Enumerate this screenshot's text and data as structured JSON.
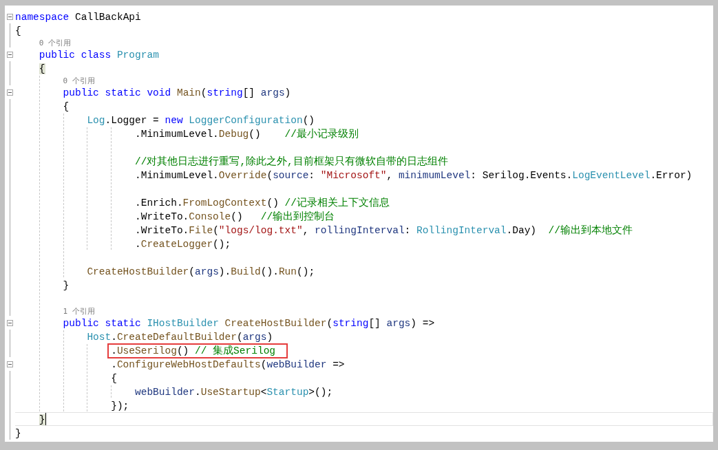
{
  "lines": [
    {
      "kind": "code",
      "expanded": true,
      "tokens": [
        {
          "kind": "kw",
          "text": "namespace"
        },
        {
          "kind": "plain",
          "text": " CallBackApi"
        }
      ]
    },
    {
      "kind": "code",
      "tokens": [
        {
          "kind": "plain",
          "text": "{"
        }
      ],
      "children": [
        {
          "kind": "lens",
          "text": "0 个引用"
        },
        {
          "kind": "code",
          "expanded": true,
          "tokens": [
            {
              "kind": "kw",
              "text": "public class"
            },
            {
              "kind": "type",
              "text": " Program"
            }
          ]
        },
        {
          "kind": "code",
          "tokens": [
            {
              "kind": "brace",
              "text": "{"
            }
          ],
          "children": [
            {
              "kind": "lens",
              "text": "0 个引用"
            },
            {
              "kind": "code",
              "expanded": true,
              "tokens": [
                {
                  "kind": "kw",
                  "text": "public static void"
                },
                {
                  "kind": "method",
                  "text": " Main"
                },
                {
                  "kind": "plain",
                  "text": "("
                },
                {
                  "kind": "kw",
                  "text": "string"
                },
                {
                  "kind": "plain",
                  "text": "[] "
                },
                {
                  "kind": "param",
                  "text": "args"
                },
                {
                  "kind": "plain",
                  "text": ")"
                }
              ]
            },
            {
              "kind": "code",
              "tokens": [
                {
                  "kind": "plain",
                  "text": "{"
                }
              ],
              "children": [
                {
                  "kind": "code",
                  "tokens": [
                    {
                      "kind": "type",
                      "text": "Log"
                    },
                    {
                      "kind": "plain",
                      "text": ".Logger = "
                    },
                    {
                      "kind": "kw",
                      "text": "new"
                    },
                    {
                      "kind": "type",
                      "text": " LoggerConfiguration"
                    },
                    {
                      "kind": "plain",
                      "text": "()"
                    }
                  ],
                  "children": [
                    {
                      "kind": "group",
                      "children": [
                        {
                          "kind": "code",
                          "tokens": [
                            {
                              "kind": "plain",
                              "text": ".MinimumLevel."
                            },
                            {
                              "kind": "method",
                              "text": "Debug"
                            },
                            {
                              "kind": "plain",
                              "text": "()    "
                            },
                            {
                              "kind": "cmt",
                              "text": "//最小记录级别"
                            }
                          ]
                        },
                        {
                          "kind": "blank"
                        },
                        {
                          "kind": "code",
                          "tokens": [
                            {
                              "kind": "cmt",
                              "text": "//对其他日志进行重写,除此之外,目前框架只有微软自带的日志组件"
                            }
                          ]
                        },
                        {
                          "kind": "code",
                          "tokens": [
                            {
                              "kind": "plain",
                              "text": ".MinimumLevel."
                            },
                            {
                              "kind": "method",
                              "text": "Override"
                            },
                            {
                              "kind": "plain",
                              "text": "("
                            },
                            {
                              "kind": "param",
                              "text": "source"
                            },
                            {
                              "kind": "plain",
                              "text": ": "
                            },
                            {
                              "kind": "str",
                              "text": "\"Microsoft\""
                            },
                            {
                              "kind": "plain",
                              "text": ", "
                            },
                            {
                              "kind": "param",
                              "text": "minimumLevel"
                            },
                            {
                              "kind": "plain",
                              "text": ": Serilog.Events."
                            },
                            {
                              "kind": "type",
                              "text": "LogEventLevel"
                            },
                            {
                              "kind": "plain",
                              "text": ".Error)"
                            }
                          ]
                        },
                        {
                          "kind": "blank"
                        },
                        {
                          "kind": "code",
                          "tokens": [
                            {
                              "kind": "plain",
                              "text": ".Enrich."
                            },
                            {
                              "kind": "method",
                              "text": "FromLogContext"
                            },
                            {
                              "kind": "plain",
                              "text": "() "
                            },
                            {
                              "kind": "cmt",
                              "text": "//记录相关上下文信息"
                            }
                          ]
                        },
                        {
                          "kind": "code",
                          "tokens": [
                            {
                              "kind": "plain",
                              "text": ".WriteTo."
                            },
                            {
                              "kind": "method",
                              "text": "Console"
                            },
                            {
                              "kind": "plain",
                              "text": "()   "
                            },
                            {
                              "kind": "cmt",
                              "text": "//输出到控制台"
                            }
                          ]
                        },
                        {
                          "kind": "code",
                          "tokens": [
                            {
                              "kind": "plain",
                              "text": ".WriteTo."
                            },
                            {
                              "kind": "method",
                              "text": "File"
                            },
                            {
                              "kind": "plain",
                              "text": "("
                            },
                            {
                              "kind": "str",
                              "text": "\"logs/log.txt\""
                            },
                            {
                              "kind": "plain",
                              "text": ", "
                            },
                            {
                              "kind": "param",
                              "text": "rollingInterval"
                            },
                            {
                              "kind": "plain",
                              "text": ": "
                            },
                            {
                              "kind": "type",
                              "text": "RollingInterval"
                            },
                            {
                              "kind": "plain",
                              "text": ".Day)  "
                            },
                            {
                              "kind": "cmt",
                              "text": "//输出到本地文件"
                            }
                          ]
                        },
                        {
                          "kind": "code",
                          "tokens": [
                            {
                              "kind": "plain",
                              "text": "."
                            },
                            {
                              "kind": "method",
                              "text": "CreateLogger"
                            },
                            {
                              "kind": "plain",
                              "text": "();"
                            }
                          ]
                        }
                      ]
                    }
                  ]
                },
                {
                  "kind": "blank"
                },
                {
                  "kind": "code",
                  "tokens": [
                    {
                      "kind": "method",
                      "text": "CreateHostBuilder"
                    },
                    {
                      "kind": "plain",
                      "text": "("
                    },
                    {
                      "kind": "param",
                      "text": "args"
                    },
                    {
                      "kind": "plain",
                      "text": ")."
                    },
                    {
                      "kind": "method",
                      "text": "Build"
                    },
                    {
                      "kind": "plain",
                      "text": "()."
                    },
                    {
                      "kind": "method",
                      "text": "Run"
                    },
                    {
                      "kind": "plain",
                      "text": "();"
                    }
                  ]
                }
              ]
            },
            {
              "kind": "code",
              "tokens": [
                {
                  "kind": "plain",
                  "text": "}"
                }
              ]
            },
            {
              "kind": "blank"
            },
            {
              "kind": "lens",
              "text": "1 个引用"
            },
            {
              "kind": "code",
              "expanded": true,
              "tokens": [
                {
                  "kind": "kw",
                  "text": "public static"
                },
                {
                  "kind": "type",
                  "text": " IHostBuilder"
                },
                {
                  "kind": "method",
                  "text": " CreateHostBuilder"
                },
                {
                  "kind": "plain",
                  "text": "("
                },
                {
                  "kind": "kw",
                  "text": "string"
                },
                {
                  "kind": "plain",
                  "text": "[] "
                },
                {
                  "kind": "param",
                  "text": "args"
                },
                {
                  "kind": "plain",
                  "text": ") =>"
                }
              ],
              "children": [
                {
                  "kind": "code",
                  "tokens": [
                    {
                      "kind": "type",
                      "text": "Host"
                    },
                    {
                      "kind": "plain",
                      "text": "."
                    },
                    {
                      "kind": "method",
                      "text": "CreateDefaultBuilder"
                    },
                    {
                      "kind": "plain",
                      "text": "("
                    },
                    {
                      "kind": "param",
                      "text": "args"
                    },
                    {
                      "kind": "plain",
                      "text": ")"
                    }
                  ],
                  "children": [
                    {
                      "kind": "code",
                      "highlighted": true,
                      "tokens": [
                        {
                          "kind": "plain",
                          "text": "."
                        },
                        {
                          "kind": "method",
                          "text": "UseSerilog"
                        },
                        {
                          "kind": "plain",
                          "text": "() "
                        },
                        {
                          "kind": "cmt",
                          "text": "// 集成Serilog"
                        }
                      ]
                    },
                    {
                      "kind": "code",
                      "expanded": true,
                      "tokens": [
                        {
                          "kind": "plain",
                          "text": "."
                        },
                        {
                          "kind": "method",
                          "text": "ConfigureWebHostDefaults"
                        },
                        {
                          "kind": "plain",
                          "text": "("
                        },
                        {
                          "kind": "param",
                          "text": "webBuilder"
                        },
                        {
                          "kind": "plain",
                          "text": " =>"
                        }
                      ]
                    },
                    {
                      "kind": "code",
                      "tokens": [
                        {
                          "kind": "plain",
                          "text": "{"
                        }
                      ],
                      "children": [
                        {
                          "kind": "code",
                          "tokens": [
                            {
                              "kind": "param",
                              "text": "webBuilder"
                            },
                            {
                              "kind": "plain",
                              "text": "."
                            },
                            {
                              "kind": "method",
                              "text": "UseStartup"
                            },
                            {
                              "kind": "plain",
                              "text": "<"
                            },
                            {
                              "kind": "type",
                              "text": "Startup"
                            },
                            {
                              "kind": "plain",
                              "text": ">();"
                            }
                          ]
                        }
                      ]
                    },
                    {
                      "kind": "code",
                      "tokens": [
                        {
                          "kind": "plain",
                          "text": "});"
                        }
                      ]
                    }
                  ]
                }
              ]
            }
          ]
        },
        {
          "kind": "code",
          "current": true,
          "tokens": [
            {
              "kind": "brace",
              "text": "}"
            }
          ]
        }
      ]
    },
    {
      "kind": "code",
      "tokens": [
        {
          "kind": "plain",
          "text": "}"
        }
      ]
    }
  ]
}
